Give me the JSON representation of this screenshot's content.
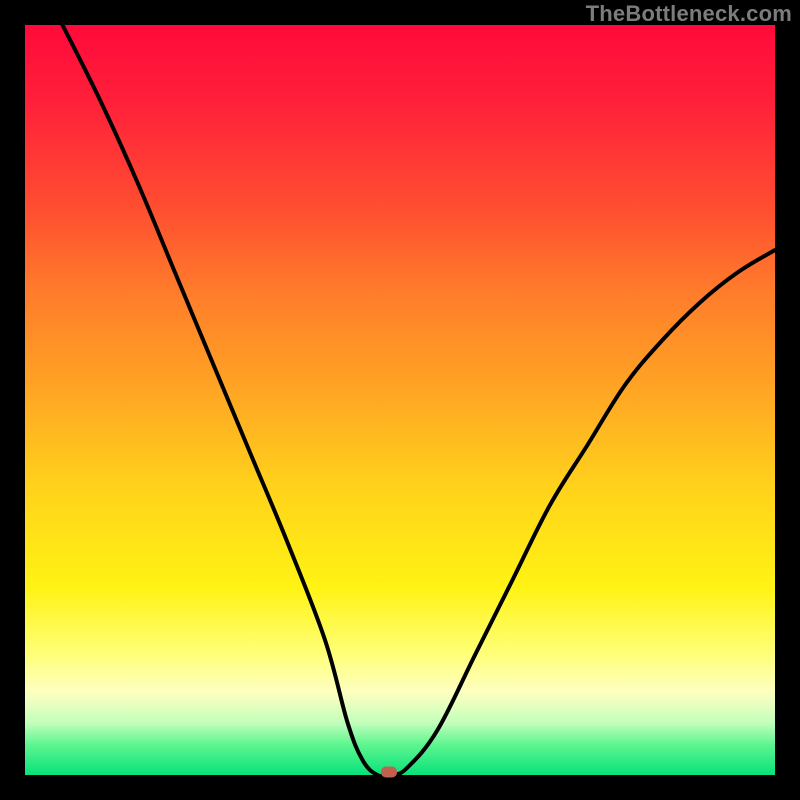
{
  "watermark": "TheBottleneck.com",
  "colors": {
    "frame": "#000000",
    "gradient_top": "#ff0a3a",
    "gradient_mid": "#ffd31b",
    "gradient_bottom": "#08e27a",
    "curve": "#000000",
    "marker": "#c1604f"
  },
  "chart_data": {
    "type": "line",
    "title": "",
    "xlabel": "",
    "ylabel": "",
    "xlim": [
      0,
      100
    ],
    "ylim": [
      0,
      100
    ],
    "grid": false,
    "legend": false,
    "series": [
      {
        "name": "curve",
        "x": [
          5,
          10,
          15,
          20,
          25,
          30,
          35,
          40,
          43,
          45,
          47,
          49,
          51,
          55,
          60,
          65,
          70,
          75,
          80,
          85,
          90,
          95,
          100
        ],
        "values": [
          100,
          90,
          79,
          67,
          55,
          43,
          31,
          18,
          7,
          2,
          0,
          0,
          1,
          6,
          16,
          26,
          36,
          44,
          52,
          58,
          63,
          67,
          70
        ]
      }
    ],
    "marker": {
      "x": 48.5,
      "y": 0
    }
  }
}
